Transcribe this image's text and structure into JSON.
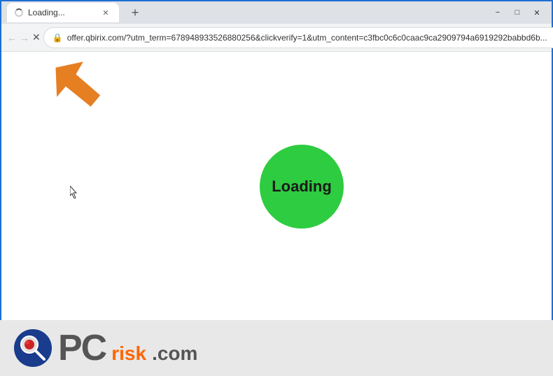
{
  "titlebar": {
    "tab_title": "Loading...",
    "new_tab_label": "+",
    "minimize_label": "−",
    "restore_label": "□",
    "close_label": "✕"
  },
  "navbar": {
    "back_label": "←",
    "forward_label": "→",
    "reload_label": "✕",
    "url": "offer.qbirix.com/?utm_term=678948933526880256&clickverify=1&utm_content=c3fbc0c6c0caac9ca2909794a6919292babbd6b...",
    "bookmark_label": "☆",
    "profile_label": "⊙",
    "menu_label": "⋮"
  },
  "content": {
    "loading_text": "Loading"
  },
  "watermark": {
    "pc_text": "PC",
    "risk_text": "risk",
    "dotcom_text": ".com"
  }
}
